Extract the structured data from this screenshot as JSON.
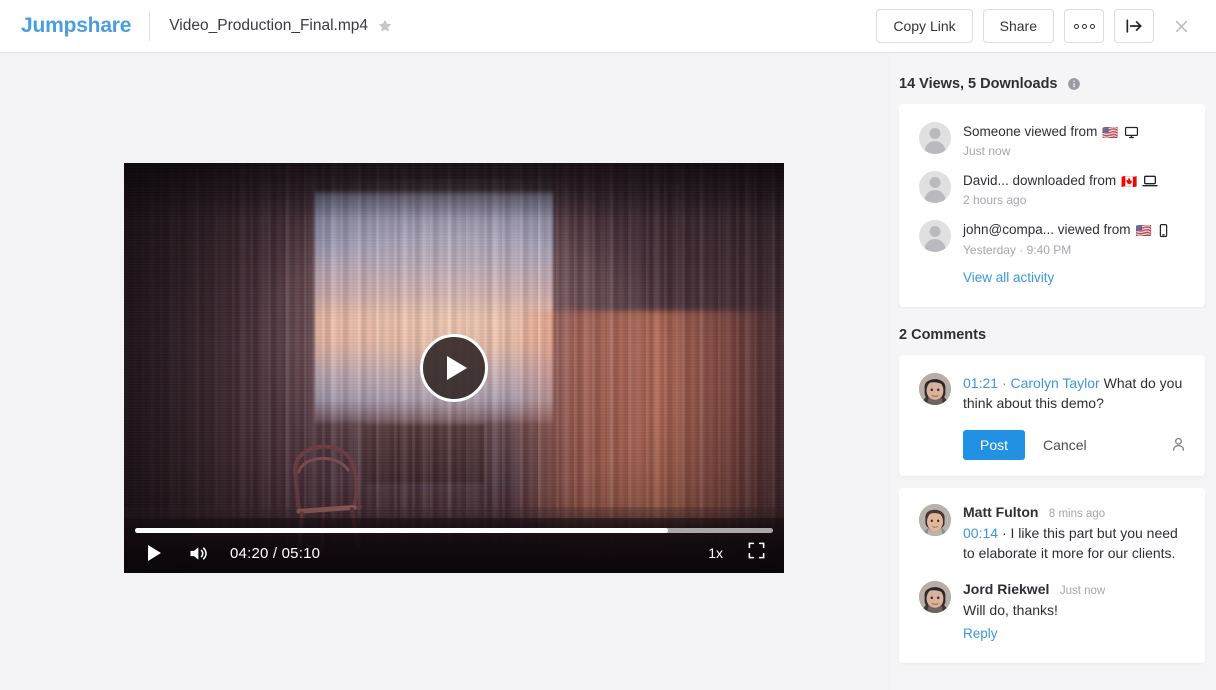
{
  "topbar": {
    "brand": "Jumpshare",
    "filename": "Video_Production_Final.mp4",
    "star_icon": "star-icon",
    "copy_link_label": "Copy Link",
    "share_label": "Share",
    "more_icon": "more-horizontal-icon",
    "collapse_icon": "collapse-panel-icon",
    "close_icon": "close-icon"
  },
  "player": {
    "play_icon": "play-icon",
    "volume_icon": "volume-on-icon",
    "timecode": "04:20 / 05:10",
    "current_time": "04:20",
    "duration": "05:10",
    "progress_percent": 83.5,
    "speed_label": "1x",
    "fullscreen_icon": "fullscreen-icon"
  },
  "sidebar": {
    "stats_label": "14 Views, 5 Downloads",
    "views": 14,
    "downloads": 5,
    "info_icon": "info-icon",
    "activity": [
      {
        "text": "Someone viewed from",
        "flag": "🇺🇸",
        "device_icon": "desktop-monitor-icon",
        "time": "Just now"
      },
      {
        "text": "David... downloaded from",
        "flag": "🇨🇦",
        "device_icon": "laptop-icon",
        "time": "2 hours ago"
      },
      {
        "text": "john@compa... viewed from",
        "flag": "🇺🇸",
        "device_icon": "mobile-phone-icon",
        "time": "Yesterday · 9:40 PM"
      }
    ],
    "view_all_label": "View all activity",
    "comments_heading": "2 Comments",
    "comments_count": 2,
    "compose": {
      "timestamp": "01:21",
      "separator": "·",
      "author": "Carolyn Taylor",
      "body": "What do you think about this demo?",
      "post_label": "Post",
      "cancel_label": "Cancel",
      "person_icon": "person-icon"
    },
    "comments": [
      {
        "name": "Matt Fulton",
        "ago": "8 mins ago",
        "timestamp": "00:14",
        "separator": "·",
        "body": "I like this part but you need to elaborate it more for our clients."
      },
      {
        "name": "Jord Riekwel",
        "ago": "Just now",
        "timestamp": "",
        "separator": "",
        "body": "Will do, thanks!",
        "reply_label": "Reply"
      }
    ]
  },
  "colors": {
    "brand_blue": "#4a9ede",
    "link_blue": "#3d97e0",
    "post_blue": "#2290e3",
    "page_bg": "#f4f4f6",
    "card_bg": "#ffffff",
    "text_dark": "#2e2e34",
    "text_muted": "#a6a6ae"
  }
}
